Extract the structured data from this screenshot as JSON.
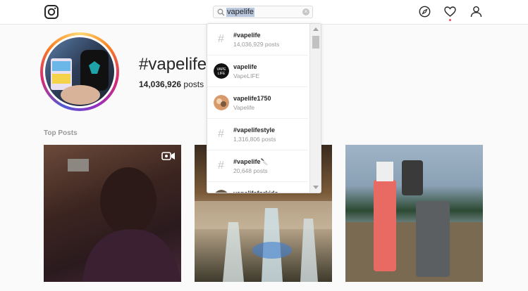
{
  "search": {
    "query": "vapelife"
  },
  "tag": {
    "title": "#vapelife",
    "post_count": "14,036,926",
    "posts_label": "posts"
  },
  "sections": {
    "top_posts": "Top Posts"
  },
  "suggestions": [
    {
      "kind": "hashtag",
      "title": "#vapelife",
      "subtitle": "14,036,929 posts"
    },
    {
      "kind": "user",
      "title": "vapelife",
      "subtitle": "VapeLIFE"
    },
    {
      "kind": "user",
      "title": "vapelife1750",
      "subtitle": "Vapelife"
    },
    {
      "kind": "hashtag",
      "title": "#vapelifestyle",
      "subtitle": "1,316,806 posts"
    },
    {
      "kind": "hashtag",
      "title": "#vapelife🔪",
      "subtitle": "20,648 posts"
    },
    {
      "kind": "user",
      "title": "vapelifeforkids",
      "subtitle": ""
    }
  ],
  "icons": {
    "logo": "instagram-logo-icon",
    "explore": "compass-icon",
    "activity": "heart-icon",
    "profile": "person-icon",
    "video": "video-camera-icon"
  },
  "colors": {
    "notification": "#ed4956",
    "search_highlight": "#b9c8de"
  }
}
